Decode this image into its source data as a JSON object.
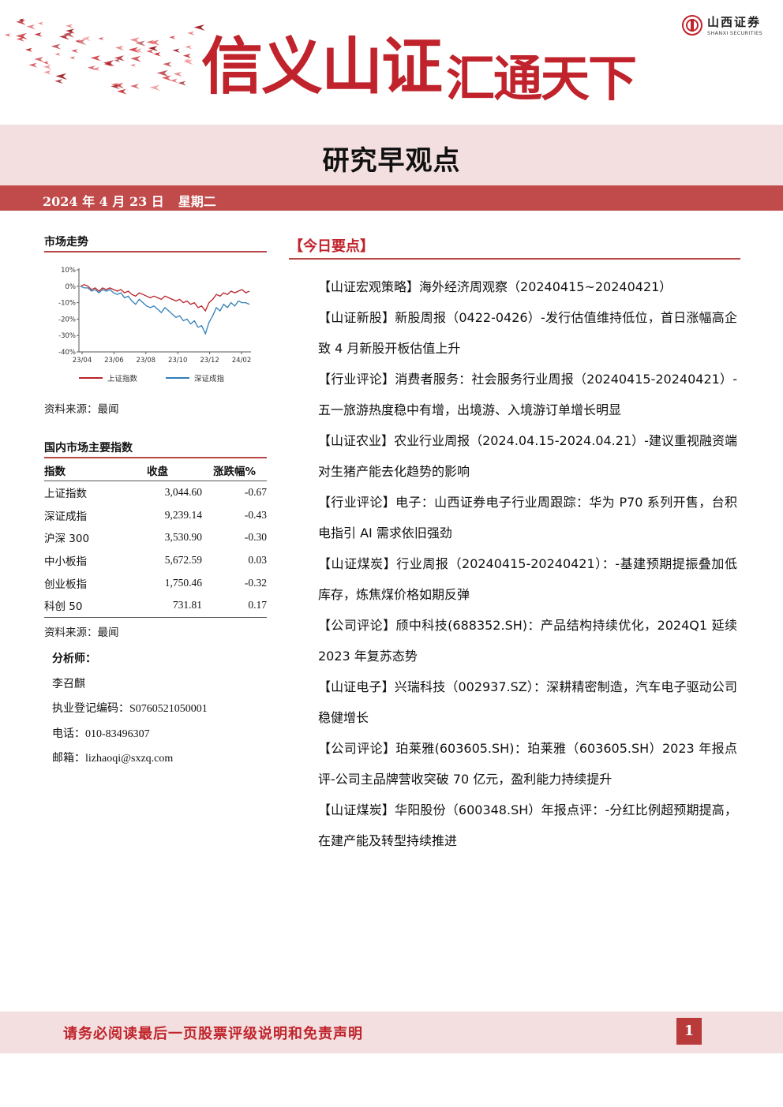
{
  "banner": {
    "slogan_part1": "信义山证",
    "slogan_part2": "汇通天下",
    "logo_name": "山西证券",
    "logo_en": "SHANXI SECURITIES"
  },
  "title": "研究早观点",
  "date": {
    "text": "2024 年 4 月 23 日",
    "weekday": "星期二"
  },
  "market": {
    "heading": "市场走势",
    "source": "资料来源：最闻",
    "chart_data": {
      "type": "line",
      "x_ticks": [
        "23/04",
        "23/06",
        "23/08",
        "23/10",
        "23/12",
        "24/02"
      ],
      "y_ticks": [
        "10%",
        "0%",
        "-10%",
        "-20%",
        "-30%",
        "-40%"
      ],
      "ylim": [
        -40,
        10
      ],
      "series": [
        {
          "name": "上证指数",
          "color": "#b8232b",
          "values": [
            0,
            1,
            0,
            -2,
            -1,
            -3,
            -1,
            -2,
            -1,
            -2,
            -3,
            -2,
            -4,
            -3,
            -5,
            -6,
            -4,
            -5,
            -6,
            -7,
            -6,
            -7,
            -8,
            -6,
            -7,
            -8,
            -9,
            -8,
            -10,
            -9,
            -11,
            -10,
            -13,
            -12,
            -15,
            -10,
            -8,
            -5,
            -6,
            -4,
            -5,
            -3,
            -4,
            -3,
            -2,
            -4,
            -3
          ]
        },
        {
          "name": "深证成指",
          "color": "#2f7fb8",
          "values": [
            0,
            -1,
            -1,
            -3,
            -2,
            -4,
            -2,
            -3,
            -2,
            -4,
            -5,
            -4,
            -7,
            -6,
            -9,
            -11,
            -8,
            -10,
            -12,
            -13,
            -12,
            -14,
            -16,
            -13,
            -15,
            -17,
            -19,
            -18,
            -21,
            -20,
            -23,
            -21,
            -25,
            -24,
            -29,
            -22,
            -18,
            -13,
            -15,
            -11,
            -13,
            -10,
            -12,
            -9,
            -10,
            -10,
            -11
          ]
        }
      ]
    }
  },
  "indices": {
    "heading": "国内市场主要指数",
    "columns": [
      "指数",
      "收盘",
      "涨跌幅%"
    ],
    "rows": [
      {
        "name": "上证指数",
        "close": "3,044.60",
        "change": "-0.67"
      },
      {
        "name": "深证成指",
        "close": "9,239.14",
        "change": "-0.43"
      },
      {
        "name": "沪深 300",
        "close": "3,530.90",
        "change": "-0.30"
      },
      {
        "name": "中小板指",
        "close": "5,672.59",
        "change": "0.03"
      },
      {
        "name": "创业板指",
        "close": "1,750.46",
        "change": "-0.32"
      },
      {
        "name": "科创 50",
        "close": "731.81",
        "change": "0.17"
      }
    ],
    "source": "资料来源：最闻"
  },
  "analyst": {
    "heading": "分析师：",
    "name": "李召麒",
    "reg_label": "执业登记编码：",
    "reg_value": "S0760521050001",
    "phone_label": "电话：",
    "phone_value": "010-83496307",
    "email_label": "邮箱：",
    "email_value": "lizhaoqi@sxzq.com"
  },
  "today": {
    "heading": "【今日要点】",
    "items": [
      {
        "tag": "【山证宏观策略】",
        "text": "海外经济周观察（20240415~20240421）"
      },
      {
        "tag": "【山证新股】",
        "text": "新股周报（0422-0426）-发行估值维持低位，首日涨幅高企致 4 月新股开板估值上升"
      },
      {
        "tag": "【行业评论】",
        "text": "消费者服务：社会服务行业周报（20240415-20240421）-五一旅游热度稳中有增，出境游、入境游订单增长明显"
      },
      {
        "tag": "【山证农业】",
        "text": "农业行业周报（2024.04.15-2024.04.21）-建议重视融资端对生猪产能去化趋势的影响"
      },
      {
        "tag": "【行业评论】",
        "text": "电子：山西证券电子行业周跟踪：华为 P70 系列开售，台积电指引 AI 需求依旧强劲"
      },
      {
        "tag": "【山证煤炭】",
        "text": "行业周报（20240415-20240421）：-基建预期提振叠加低库存，炼焦煤价格如期反弹"
      },
      {
        "tag": "【公司评论】",
        "text": "颀中科技(688352.SH)：产品结构持续优化，2024Q1 延续 2023 年复苏态势"
      },
      {
        "tag": "【山证电子】",
        "text": "兴瑞科技（002937.SZ）：深耕精密制造，汽车电子驱动公司稳健增长"
      },
      {
        "tag": "【公司评论】",
        "text": "珀莱雅(603605.SH)：珀莱雅（603605.SH）2023 年报点评-公司主品牌营收突破 70 亿元，盈利能力持续提升"
      },
      {
        "tag": "【山证煤炭】",
        "text": "华阳股份（600348.SH）年报点评：-分红比例超预期提高，在建产能及转型持续推进"
      }
    ]
  },
  "footer": {
    "text": "请务必阅读最后一页股票评级说明和免责声明",
    "page": "1"
  }
}
